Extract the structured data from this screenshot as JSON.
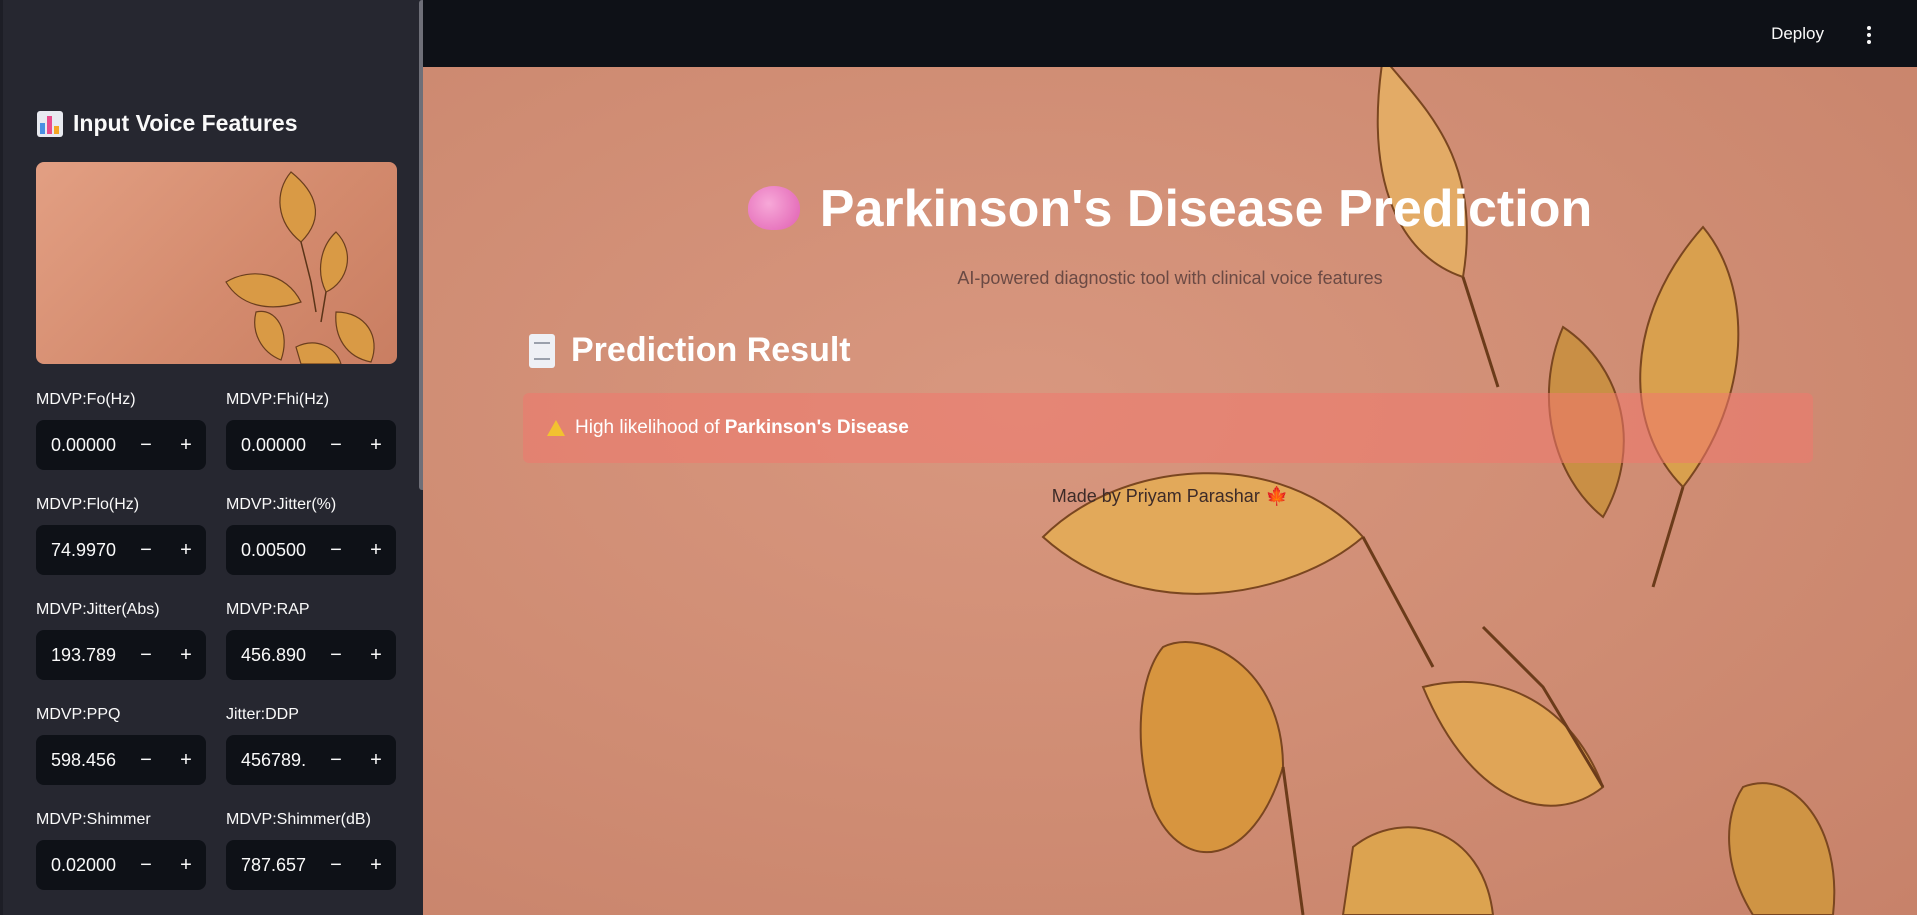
{
  "sidebar": {
    "title": "Input Voice Features",
    "fields": [
      {
        "label": "MDVP:Fo(Hz)",
        "value": "0.00000"
      },
      {
        "label": "MDVP:Fhi(Hz)",
        "value": "0.00000"
      },
      {
        "label": "MDVP:Flo(Hz)",
        "value": "74.9970"
      },
      {
        "label": "MDVP:Jitter(%)",
        "value": "0.00500"
      },
      {
        "label": "MDVP:Jitter(Abs)",
        "value": "193.789"
      },
      {
        "label": "MDVP:RAP",
        "value": "456.890"
      },
      {
        "label": "MDVP:PPQ",
        "value": "598.456"
      },
      {
        "label": "Jitter:DDP",
        "value": "456789."
      },
      {
        "label": "MDVP:Shimmer",
        "value": "0.02000"
      },
      {
        "label": "MDVP:Shimmer(dB)",
        "value": "787.657"
      }
    ],
    "minus": "−",
    "plus": "+"
  },
  "header": {
    "deploy_label": "Deploy"
  },
  "main": {
    "title": "Parkinson's Disease Prediction",
    "subtitle": "AI-powered diagnostic tool with clinical voice features",
    "section_title": "Prediction Result",
    "alert_prefix": "High likelihood of",
    "alert_strong": "Parkinson's Disease",
    "footer": "Made by Priyam Parashar",
    "footer_glyph": "🍁"
  },
  "colors": {
    "sidebar_bg": "#262730",
    "input_bg": "#0e1117",
    "topbar_bg": "#0e1117",
    "main_bg": "#cf8c73",
    "alert_bg": "#f0786e"
  },
  "icons": [
    "bar-chart-icon",
    "brain-icon",
    "receipt-icon",
    "warning-icon",
    "kebab-menu-icon",
    "maple-leaf-icon"
  ]
}
